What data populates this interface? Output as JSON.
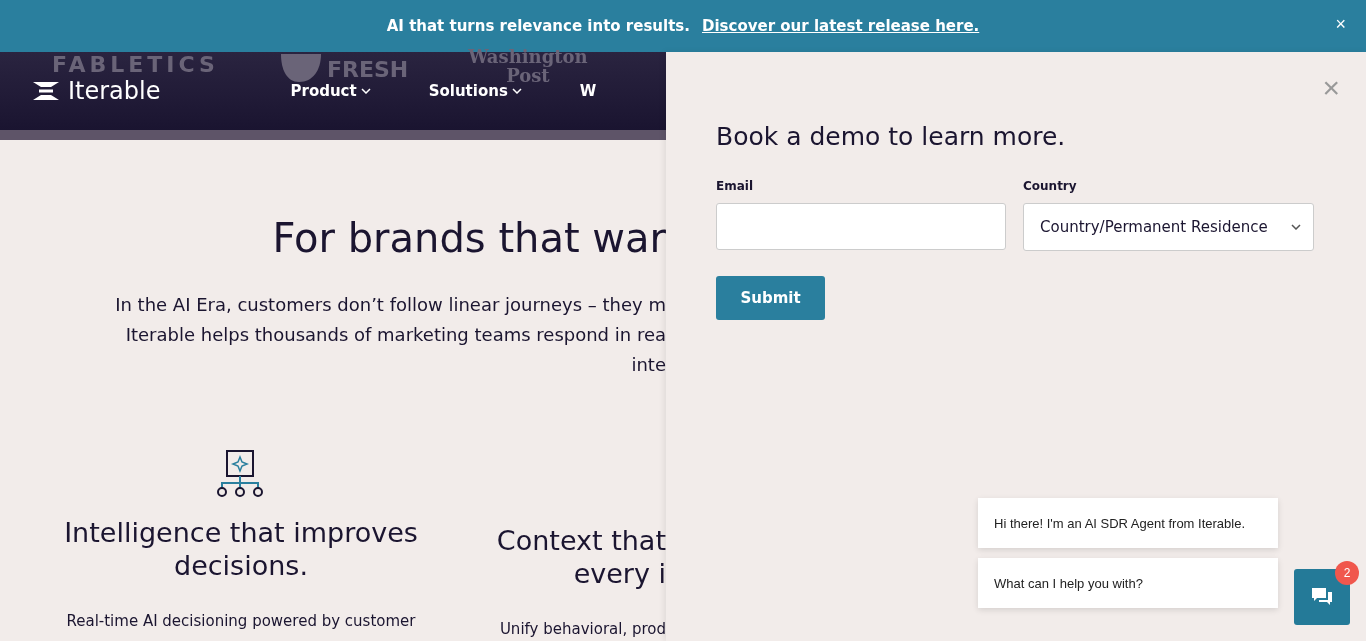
{
  "announcement": {
    "text": "AI that turns relevance into results.",
    "link": "Discover our latest release here.",
    "close": "×"
  },
  "logo_strip": [
    "FABLETICS",
    "FRESH",
    "Washington",
    "Post"
  ],
  "header": {
    "brand": "Iterable",
    "nav": [
      {
        "label": "Product",
        "dropdown": true
      },
      {
        "label": "Solutions",
        "dropdown": true
      },
      {
        "label": "W",
        "dropdown": false
      }
    ]
  },
  "hero": {
    "heading": "For brands that war",
    "lines": [
      "In the AI Era, customers don’t follow linear journeys – they m",
      "Iterable helps thousands of marketing teams respond in rea",
      "inte"
    ]
  },
  "features": [
    {
      "title_lines": [
        "Intelligence that improves",
        "decisions."
      ],
      "body": "Real-time AI decisioning powered by customer"
    },
    {
      "title_lines": [
        "Context that",
        "every i"
      ],
      "body": "Unify behavioral, prod"
    }
  ],
  "demo_panel": {
    "close": "×",
    "title": "Book a demo to learn more.",
    "email": {
      "label": "Email"
    },
    "country": {
      "label": "Country",
      "value": "Country/Permanent Residence"
    },
    "submit": "Submit"
  },
  "chat": {
    "messages": [
      "Hi there! I'm an AI SDR Agent from Iterable.",
      "What can I help you with?"
    ],
    "badge": "2"
  }
}
